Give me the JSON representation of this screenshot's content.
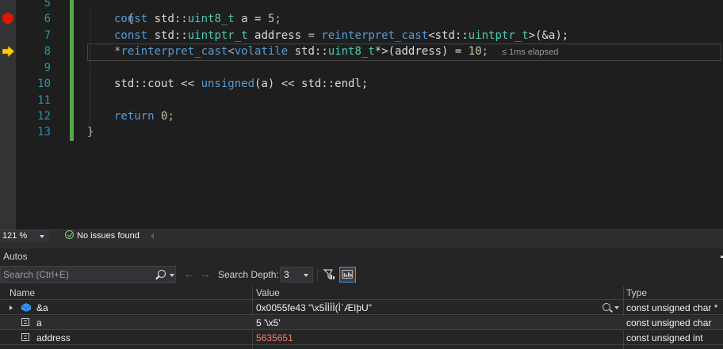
{
  "editor": {
    "line_numbers": [
      "5",
      "6",
      "7",
      "8",
      "9",
      "10",
      "11",
      "12",
      "13"
    ],
    "code": {
      "l5": "{",
      "l6_kw": "const",
      "l6_ns": " std::",
      "l6_type": "uint8_t",
      "l6_rest": " a = ",
      "l6_num": "5",
      "l6_end": ";",
      "l7_kw": "const",
      "l7_ns": " std::",
      "l7_type": "uintptr_t",
      "l7_var": " address",
      "l7_eq": " = ",
      "l7_cast": "reinterpret_cast",
      "l7_lt": "<std::",
      "l7_type2": "uintptr_t",
      "l7_end": ">(&a);",
      "l8_star": "*",
      "l8_cast": "reinterpret_cast",
      "l8_lt": "<",
      "l8_kw": "volatile",
      "l8_ns": " std::",
      "l8_type": "uint8_t",
      "l8_mid": "*>(address) = ",
      "l8_num": "10",
      "l8_end": ";",
      "l10_a": "std::cout << ",
      "l10_kw": "unsigned",
      "l10_b": "(a) << std::endl;",
      "l12_kw": "return",
      "l12_num": " 0",
      "l12_end": ";",
      "l13": "}"
    },
    "perf_tip": "≤ 1ms elapsed",
    "breakpoint_color": "#e51400",
    "change_bar_color": "#57a64a"
  },
  "status": {
    "zoom": "121 %",
    "issues": "No issues found"
  },
  "autos": {
    "title": "Autos",
    "search_placeholder": "Search (Ctrl+E)",
    "search_depth_label": "Search Depth:",
    "search_depth_value": "3",
    "columns": {
      "name": "Name",
      "value": "Value",
      "type": "Type"
    },
    "rows": [
      {
        "name": "&a",
        "value": "0x0055fe43 \"\\x5ÌÌÌÌ(Ì`ÆIþU\"",
        "type": "const unsigned char *"
      },
      {
        "name": "a",
        "value": "5 '\\x5'",
        "type": "const unsigned char"
      },
      {
        "name": "address",
        "value": "5635651",
        "type": "const unsigned int"
      }
    ]
  }
}
